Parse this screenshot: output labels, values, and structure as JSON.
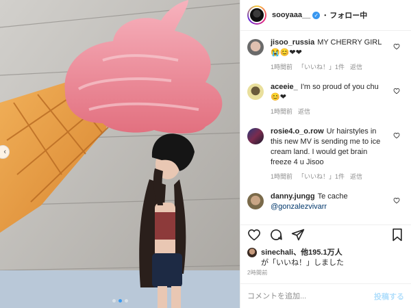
{
  "post": {
    "image_icons": {
      "nav_prev": "chevron-left-icon"
    },
    "carousel": {
      "total_slides": 3,
      "active_index": 1
    }
  },
  "header": {
    "username": "sooyaaa__",
    "verified_icon": "verified-badge-icon",
    "separator": "・",
    "follow_label": "フォロー中"
  },
  "comments": [
    {
      "username": "jisoo_russia",
      "text": "MY CHERRY GIRL😭😊❤❤",
      "time": "1時間前",
      "likes": "「いいね！」1件",
      "reply": "返信"
    },
    {
      "username": "aceeie_",
      "text": "I'm so proud of you chu 😊❤",
      "time": "1時間前",
      "reply": "返信"
    },
    {
      "username": "rosie4.o_o.row",
      "text": "Ur hairstyles in this new MV is sending me to ice cream land. I would get brain freeze 4 u Jisoo",
      "time": "1時間前",
      "likes": "「いいね！」1件",
      "reply": "返信"
    },
    {
      "username": "danny.jungg",
      "text": "Te cache",
      "mention": "@gonzalezvivarr"
    }
  ],
  "actions": {
    "like": "heart-icon",
    "comment": "comment-icon",
    "share": "share-icon",
    "save": "bookmark-icon"
  },
  "likes": {
    "user": "sinechali",
    "others": "、他195.1万人",
    "suffix": "が「いいね！」しました"
  },
  "timestamp": "2時間前",
  "add_comment": {
    "placeholder": "コメントを追加...",
    "post_label": "投稿する"
  },
  "colors": {
    "accent": "#3897f0",
    "post_button_disabled": "#b2dffc",
    "meta_gray": "#8e8e8e"
  }
}
